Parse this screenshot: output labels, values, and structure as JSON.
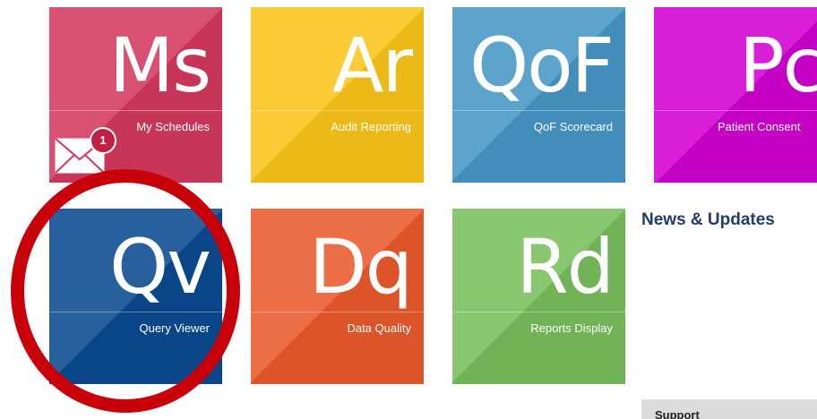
{
  "tiles": {
    "ms": {
      "abbr": "Ms",
      "label": "My Schedules",
      "color": "#d3385e"
    },
    "ar": {
      "abbr": "Ar",
      "label": "Audit Reporting",
      "color": "#fbc51a"
    },
    "qof": {
      "abbr": "QoF",
      "label": "QoF Scorecard",
      "color": "#4797c5"
    },
    "pc": {
      "abbr": "Pc",
      "label": "Patient Consent",
      "color": "#d100d1"
    },
    "qv": {
      "abbr": "Qv",
      "label": "Query Viewer",
      "color": "#0a4a8f"
    },
    "dq": {
      "abbr": "Dq",
      "label": "Data Quality",
      "color": "#ea5a2c"
    },
    "rd": {
      "abbr": "Rd",
      "label": "Reports Display",
      "color": "#79be5c"
    }
  },
  "notifications": {
    "count": "1",
    "icon": "mail-icon"
  },
  "news": {
    "title": "News & Updates"
  },
  "support": {
    "label": "Support"
  },
  "highlight": {
    "color": "#c8000a",
    "target": "Query Viewer"
  }
}
